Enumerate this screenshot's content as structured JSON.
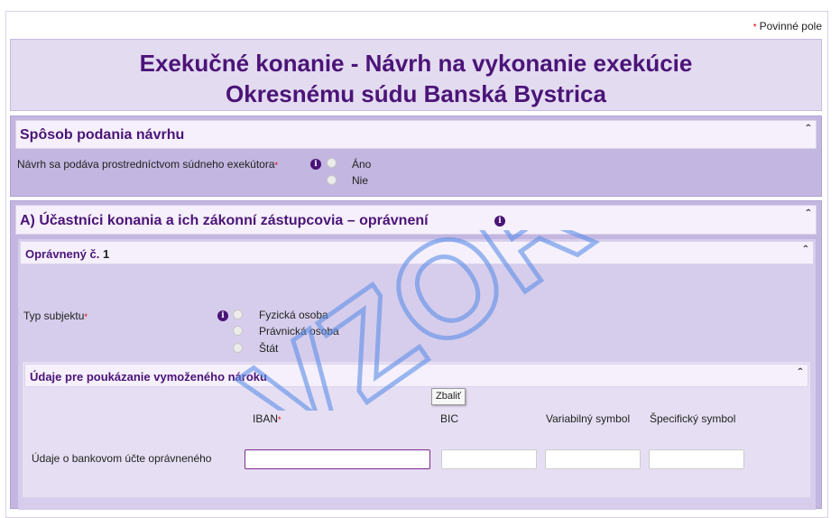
{
  "required_note": "Povinné pole",
  "title": {
    "line1": "Exekučné konanie - Návrh na vykonanie exekúcie",
    "line2": "Okresnému súdu Banská Bystrica"
  },
  "section_submission": {
    "header": "Spôsob podania návrhu",
    "question": "Návrh sa podáva prostredníctvom súdneho exekútora",
    "options": [
      "Áno",
      "Nie"
    ]
  },
  "section_a": {
    "header": "A) Účastníci konania a ich zákonní zástupcovia – oprávnení",
    "claimant": {
      "header_prefix": "Oprávnený č.",
      "number": "1",
      "subject_type_label": "Typ subjektu",
      "subject_options": [
        "Fyzická osoba",
        "Právnická osoba",
        "Štát"
      ]
    },
    "payment": {
      "header": "Údaje pre poukázanie vymoženého nároku",
      "columns": [
        "IBAN",
        "BIC",
        "Variabilný symbol",
        "Špecifický symbol"
      ],
      "row_label": "Údaje o bankovom účte oprávneného",
      "values": {
        "iban": "",
        "bic": "",
        "variable_symbol": "",
        "specific_symbol": ""
      }
    }
  },
  "collapse_glyph": "ˆ",
  "tooltip": "Zbaliť",
  "watermark": "VZOR",
  "colors": {
    "title_text": "#4b1478",
    "section_bg": "#c3b6e0",
    "header_bg": "#f5f0fb",
    "required": "#d00000",
    "watermark": "#5b8ee8"
  }
}
